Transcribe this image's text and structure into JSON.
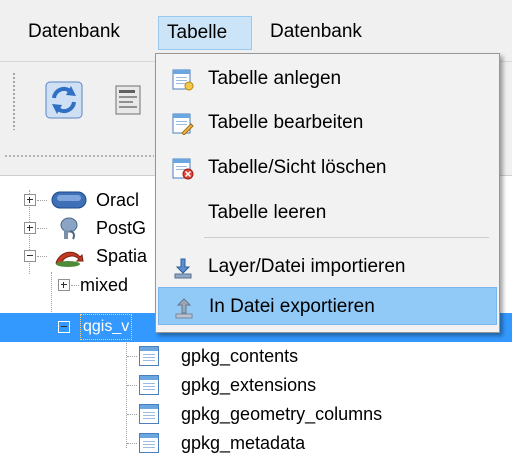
{
  "menubar": {
    "items": [
      {
        "label": "Datenbank"
      },
      {
        "label": "Tabelle"
      },
      {
        "label": "Datenbank"
      }
    ]
  },
  "toolbar": {
    "buttons": [
      {
        "icon": "refresh-icon"
      },
      {
        "icon": "sql-window-icon"
      }
    ]
  },
  "tree": {
    "items": [
      {
        "label": "Oracl",
        "icon": "oracle-icon"
      },
      {
        "label": "PostG",
        "icon": "postgis-icon"
      },
      {
        "label": "Spatia",
        "icon": "spatialite-icon"
      },
      {
        "label": "mixed"
      },
      {
        "label": "qgis_v"
      },
      {
        "label": "gpkg_contents",
        "icon": "table-icon"
      },
      {
        "label": "gpkg_extensions",
        "icon": "table-icon"
      },
      {
        "label": "gpkg_geometry_columns",
        "icon": "table-icon"
      },
      {
        "label": "gpkg_metadata",
        "icon": "table-icon"
      }
    ]
  },
  "dropdown": {
    "items": [
      {
        "label": "Tabelle anlegen",
        "icon": "create-table-icon"
      },
      {
        "label": "Tabelle bearbeiten",
        "icon": "edit-table-icon"
      },
      {
        "label": "Tabelle/Sicht löschen",
        "icon": "delete-table-icon"
      },
      {
        "label": "Tabelle leeren"
      },
      {
        "label": "Layer/Datei importieren",
        "icon": "import-icon"
      },
      {
        "label": "In Datei exportieren",
        "icon": "export-icon"
      }
    ]
  },
  "colors": {
    "selection": "#3399ff",
    "menu_highlight": "#91c9f7"
  }
}
